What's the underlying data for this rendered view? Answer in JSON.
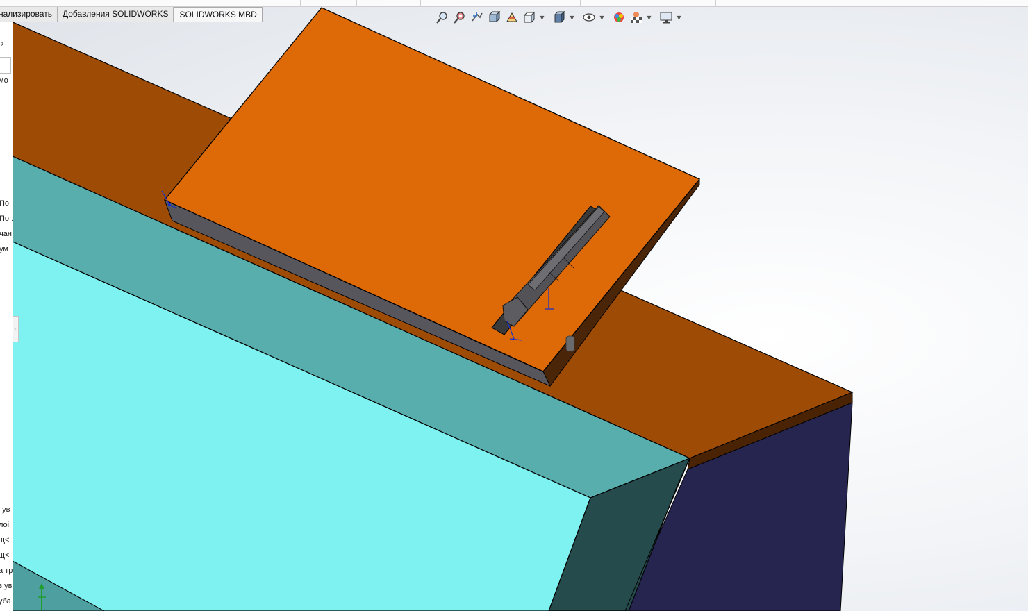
{
  "tabs": [
    {
      "label": "нализировать",
      "active": false
    },
    {
      "label": "Добавления SOLIDWORKS",
      "active": false
    },
    {
      "label": "SOLIDWORKS MBD",
      "active": true
    }
  ],
  "view_toolbar": [
    {
      "icon": "zoom-to-fit-icon"
    },
    {
      "icon": "zoom-to-area-icon"
    },
    {
      "icon": "previous-view-icon"
    },
    {
      "icon": "section-view-icon"
    },
    {
      "icon": "dynamic-annotation-views-icon"
    },
    {
      "icon": "view-orientation-icon",
      "dropdown": true
    },
    {
      "icon": "display-style-icon",
      "dropdown": true
    },
    {
      "icon": "hide-show-items-icon",
      "dropdown": true
    },
    {
      "icon": "edit-appearance-icon"
    },
    {
      "icon": "apply-scene-icon",
      "dropdown": true
    },
    {
      "icon": "view-settings-icon",
      "dropdown": true
    }
  ],
  "left_panel": {
    "rows_top": [
      "мо"
    ],
    "rows_mid": [
      "По",
      "По :",
      "чан",
      "ум"
    ],
    "rows_bottom": [
      "' ув",
      "лоі",
      "щ<",
      "щ<",
      "а тр",
      "з ув",
      "уба"
    ]
  },
  "colors": {
    "orange_top": "#de6b06",
    "brown_box_top": "#9e4c05",
    "teal_face": "#58adad",
    "cyan_face": "#7ef4f2",
    "dark_teal_face": "#264b4c",
    "navy_face": "#262550",
    "handle_gray": "#4d4d50"
  }
}
